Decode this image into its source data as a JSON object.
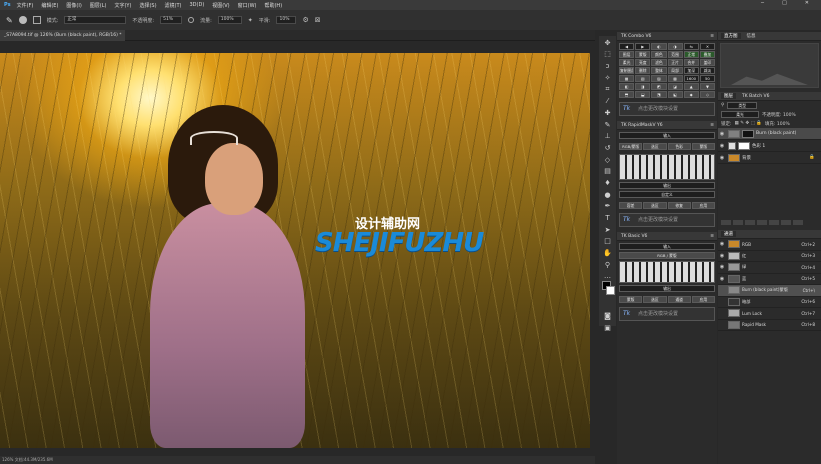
{
  "menubar": {
    "logo": "Ps",
    "items": [
      "文件(F)",
      "编辑(E)",
      "图像(I)",
      "图层(L)",
      "文字(Y)",
      "选择(S)",
      "滤镜(T)",
      "3D(D)",
      "视图(V)",
      "窗口(W)",
      "帮助(H)"
    ],
    "window_controls": [
      "─",
      "□",
      "✕"
    ]
  },
  "options": {
    "mode_label": "模式:",
    "mode_value": "正常",
    "opacity_label": "不透明度:",
    "opacity_value": "51%",
    "flow_label": "流量:",
    "flow_value": "100%",
    "smooth_label": "平滑:",
    "smooth_value": "10%"
  },
  "document": {
    "tab_title": "_S7A8094.tif @ 126% (Burn (black paint), RGB/16) *",
    "status": "126%    文档:44.3M/235.6M"
  },
  "watermark": {
    "cn": "设计辅助网",
    "en": "SHEJIFUZHU"
  },
  "tk_combo": {
    "title": "TK Combo V6",
    "slot_text": "点击更改模块设置",
    "grid_labels": [
      "图层",
      "蒙版",
      "颜色",
      "范围",
      "正常",
      "叠加",
      "柔光",
      "亮度",
      "滤色",
      "正片",
      "合并",
      "盖印",
      "复制图层",
      "删除",
      "整体",
      "局部",
      "加深",
      "减淡",
      "1600",
      "50"
    ]
  },
  "tk_rapid": {
    "title": "TK RapidMaskV Y6",
    "header1": "输入",
    "row1": [
      "RGB/蒙版",
      "选区",
      "色彩",
      "蒙版"
    ],
    "header2": "输出",
    "custom": "自定义",
    "row3": [
      "容差",
      "选区",
      "修复",
      "应用"
    ],
    "slot_text": "点击更改模块设置"
  },
  "tk_basic": {
    "title": "TK Basic V6",
    "header1": "输入",
    "rgb": "RGB / 蒙版",
    "header2": "输出",
    "row_out": [
      "蒙版",
      "选区",
      "通道",
      "应用"
    ],
    "slot_text": "点击更改模块设置"
  },
  "right_panels": {
    "top_tabs": [
      "直方图",
      "信息"
    ],
    "layers_tabs": [
      "图层",
      "TK Batch V6"
    ],
    "kind_label": "类型",
    "blend": "柔光",
    "opacity": "不透明度: 100%",
    "fill": "填充: 100%",
    "lock_label": "锁定:",
    "layers": [
      {
        "name": "Burn (black paint)",
        "thumb": "#808080"
      },
      {
        "name": "色彩 1",
        "thumb": "#e0e0e0"
      },
      {
        "name": "背景",
        "thumb": "#c8882a"
      }
    ],
    "channels_tab": "通道",
    "channels": [
      {
        "name": "RGB",
        "shortcut": "Ctrl+2"
      },
      {
        "name": "红",
        "shortcut": "Ctrl+3"
      },
      {
        "name": "绿",
        "shortcut": "Ctrl+4"
      },
      {
        "name": "蓝",
        "shortcut": "Ctrl+5"
      },
      {
        "name": "Burn (black paint)蒙版",
        "shortcut": "Ctrl+\\"
      },
      {
        "name": "暗部",
        "shortcut": "Ctrl+6"
      },
      {
        "name": "Lum Lock",
        "shortcut": "Ctrl+7"
      },
      {
        "name": "Rapid Mask",
        "shortcut": "Ctrl+8"
      }
    ]
  },
  "tools": [
    "move",
    "marquee",
    "lasso",
    "magic",
    "crop",
    "eyedrop",
    "heal",
    "brush",
    "stamp",
    "history",
    "eraser",
    "gradient",
    "blur",
    "dodge",
    "pen",
    "type",
    "path",
    "shape",
    "hand",
    "zoom",
    "more"
  ]
}
